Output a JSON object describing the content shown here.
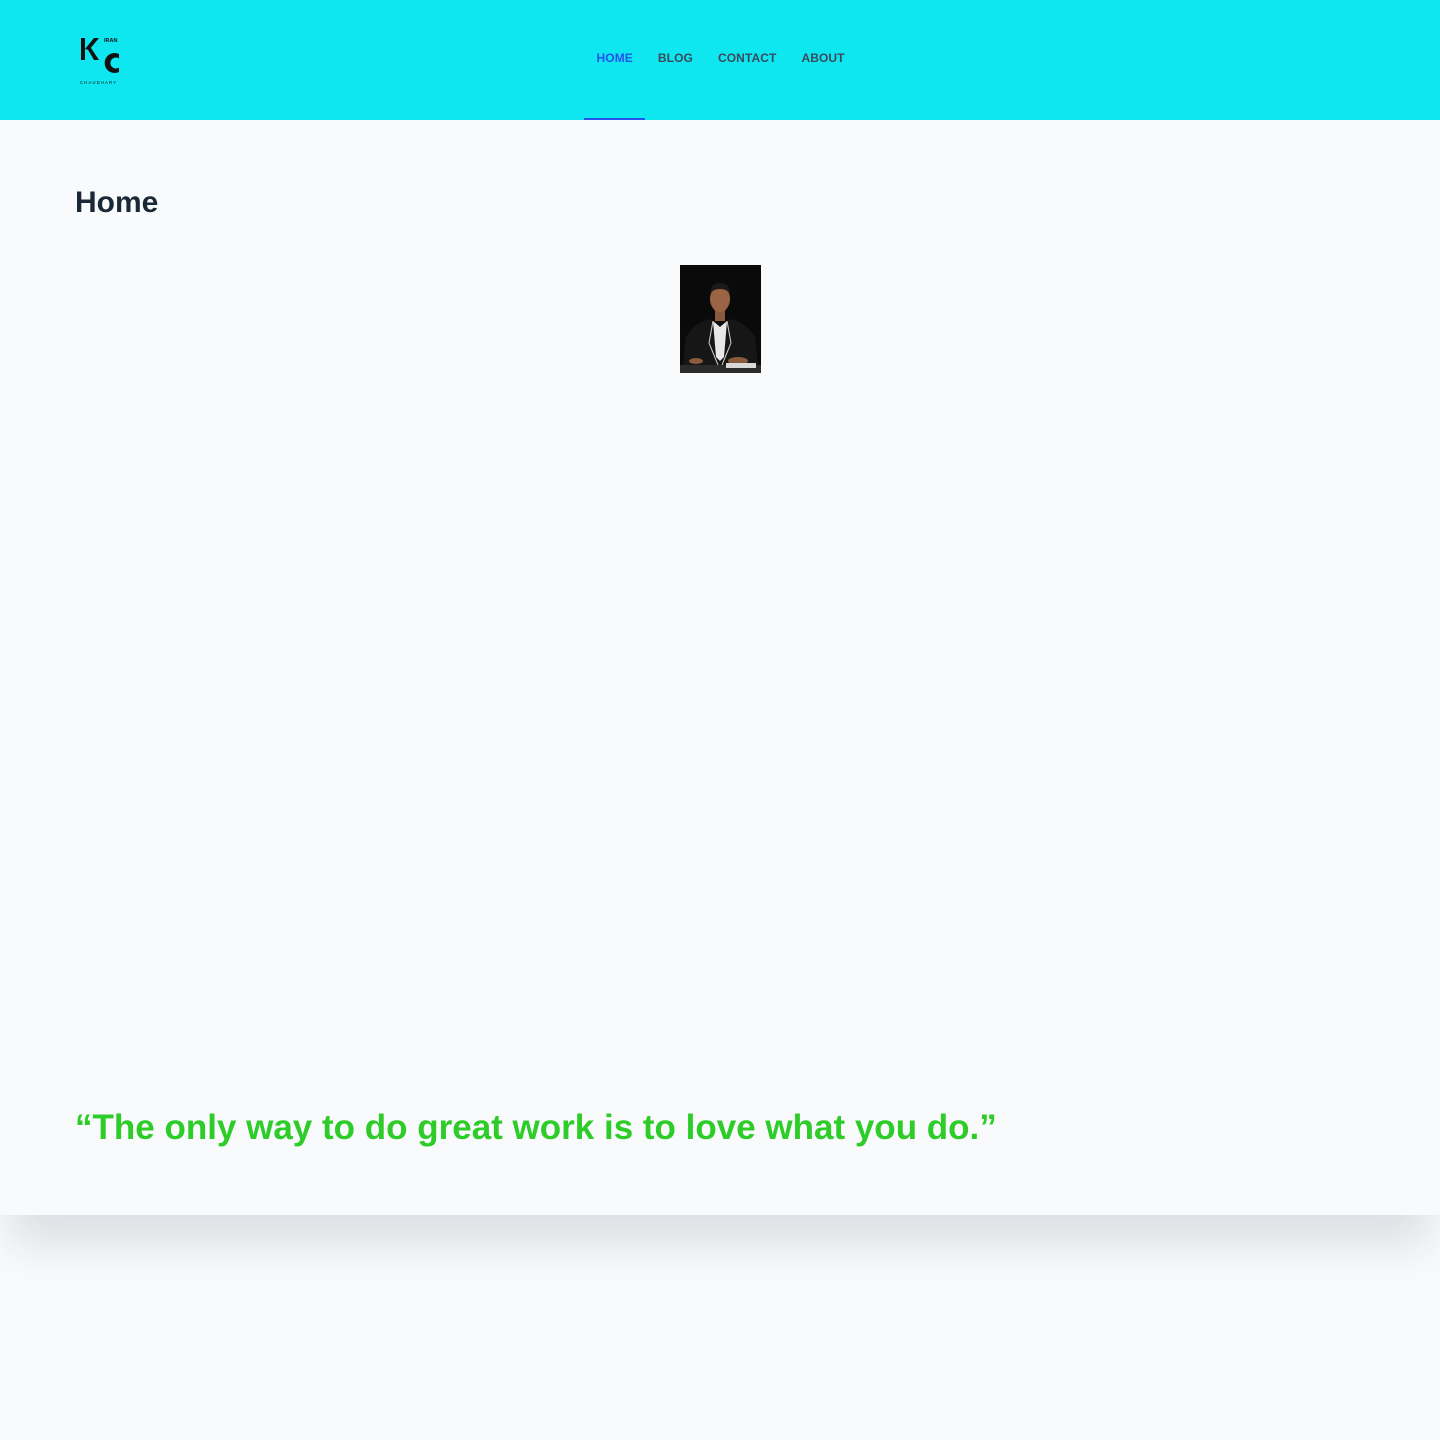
{
  "header": {
    "logo": {
      "letters": "KC",
      "top_text": "IRAN",
      "bottom_text": "CHAUDHARY",
      "icon": "kc-monogram-logo"
    },
    "nav": [
      {
        "label": "HOME",
        "active": true
      },
      {
        "label": "BLOG",
        "active": false
      },
      {
        "label": "CONTACT",
        "active": false
      },
      {
        "label": "ABOUT",
        "active": false
      }
    ]
  },
  "main": {
    "title": "Home",
    "photo": "portrait-photo",
    "quote": "“The only way to do great work is to love what you do.”"
  },
  "colors": {
    "header_bg": "#0ee6f0",
    "nav_active": "#2553ee",
    "nav_text": "#3a4a5c",
    "page_bg": "#f8fafc",
    "title": "#1b2838",
    "quote": "#2ecc28"
  }
}
